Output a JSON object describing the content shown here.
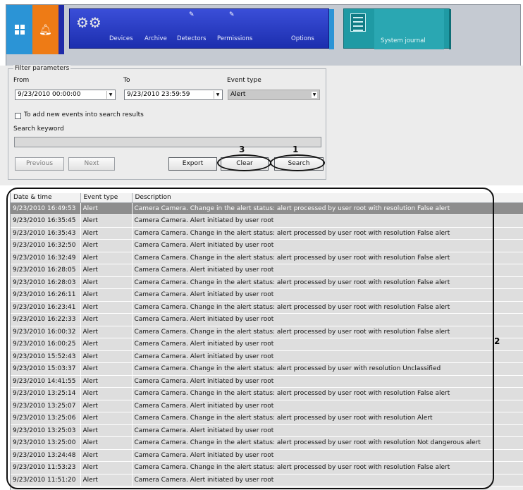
{
  "toolbar": {
    "menu_items": [
      "Devices",
      "Archive",
      "Detectors",
      "Permissions",
      "Options"
    ],
    "journal_label": "System journal"
  },
  "filter": {
    "legend": "Filter parameters",
    "from_label": "From",
    "from_value": "9/23/2010 00:00:00",
    "to_label": "To",
    "to_value": "9/23/2010 23:59:59",
    "event_type_label": "Event type",
    "event_type_value": "Alert",
    "add_new_label": "To add new events into search results",
    "add_new_checked": false,
    "keyword_label": "Search keyword",
    "keyword_value": ""
  },
  "buttons": {
    "previous": "Previous",
    "next": "Next",
    "export": "Export",
    "clear": "Clear",
    "search": "Search"
  },
  "callouts": {
    "search": "1",
    "grid": "2",
    "clear": "3"
  },
  "table": {
    "columns": [
      "Date & time",
      "Event type",
      "Description"
    ],
    "rows": [
      [
        "9/23/2010 16:49:53",
        "Alert",
        "Camera Camera. Change in the alert status: alert processed by user root with resolution False alert"
      ],
      [
        "9/23/2010 16:35:45",
        "Alert",
        "Camera Camera. Alert initiated by user root"
      ],
      [
        "9/23/2010 16:35:43",
        "Alert",
        "Camera Camera. Change in the alert status: alert processed by user root with resolution False alert"
      ],
      [
        "9/23/2010 16:32:50",
        "Alert",
        "Camera Camera. Alert initiated by user root"
      ],
      [
        "9/23/2010 16:32:49",
        "Alert",
        "Camera Camera. Change in the alert status: alert processed by user root with resolution False alert"
      ],
      [
        "9/23/2010 16:28:05",
        "Alert",
        "Camera Camera. Alert initiated by user root"
      ],
      [
        "9/23/2010 16:28:03",
        "Alert",
        "Camera Camera. Change in the alert status: alert processed by user root with resolution False alert"
      ],
      [
        "9/23/2010 16:26:11",
        "Alert",
        "Camera Camera. Alert initiated by user root"
      ],
      [
        "9/23/2010 16:23:41",
        "Alert",
        "Camera Camera. Change in the alert status: alert processed by user root with resolution False alert"
      ],
      [
        "9/23/2010 16:22:33",
        "Alert",
        "Camera Camera. Alert initiated by user root"
      ],
      [
        "9/23/2010 16:00:32",
        "Alert",
        "Camera Camera. Change in the alert status: alert processed by user root with resolution False alert"
      ],
      [
        "9/23/2010 16:00:25",
        "Alert",
        "Camera Camera. Alert initiated by user root"
      ],
      [
        "9/23/2010 15:52:43",
        "Alert",
        "Camera Camera. Alert initiated by user root"
      ],
      [
        "9/23/2010 15:03:37",
        "Alert",
        "Camera Camera. Change in the alert status: alert processed by user  with resolution Unclassified"
      ],
      [
        "9/23/2010 14:41:55",
        "Alert",
        "Camera Camera. Alert initiated by user root"
      ],
      [
        "9/23/2010 13:25:14",
        "Alert",
        "Camera Camera. Change in the alert status: alert processed by user root with resolution False alert"
      ],
      [
        "9/23/2010 13:25:07",
        "Alert",
        "Camera Camera. Alert initiated by user root"
      ],
      [
        "9/23/2010 13:25:06",
        "Alert",
        "Camera Camera. Change in the alert status: alert processed by user root with resolution Alert"
      ],
      [
        "9/23/2010 13:25:03",
        "Alert",
        "Camera Camera. Alert initiated by user root"
      ],
      [
        "9/23/2010 13:25:00",
        "Alert",
        "Camera Camera. Change in the alert status: alert processed by user root with resolution Not dangerous  alert"
      ],
      [
        "9/23/2010 13:24:48",
        "Alert",
        "Camera Camera. Alert initiated by user root"
      ],
      [
        "9/23/2010 11:53:23",
        "Alert",
        "Camera Camera. Change in the alert status: alert processed by user root with resolution False alert"
      ],
      [
        "9/23/2010 11:51:20",
        "Alert",
        "Camera Camera. Alert initiated by user root"
      ]
    ]
  },
  "colors": {
    "home_tile": "#2b94d6",
    "alarm_tile": "#ee7b15",
    "menu_bar": "#2a3cc8",
    "journal_tile": "#1f9aa4",
    "selected_row": "#8d8d8d"
  },
  "icons": [
    "home-icon",
    "bell-icon",
    "gears-icon",
    "pencil-icon",
    "journal-icon",
    "chevron-down-icon"
  ]
}
